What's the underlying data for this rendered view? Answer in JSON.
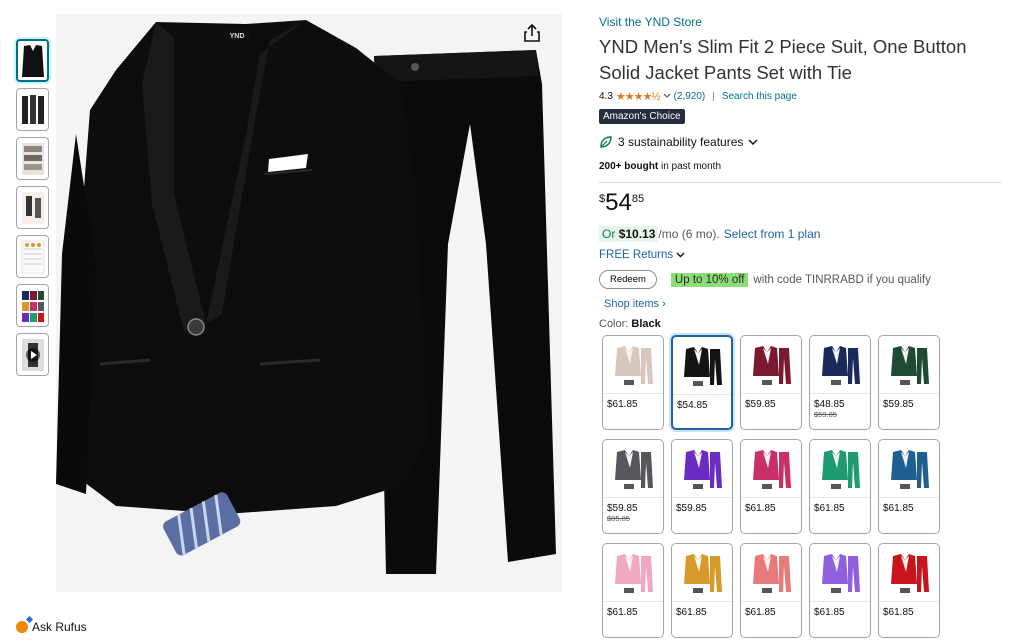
{
  "thumbnails": [
    {
      "name": "thumb-suit-front",
      "selected": true
    },
    {
      "name": "thumb-models"
    },
    {
      "name": "thumb-fabric-details"
    },
    {
      "name": "thumb-size-chart"
    },
    {
      "name": "thumb-size-table"
    },
    {
      "name": "thumb-color-grid"
    },
    {
      "name": "thumb-video"
    }
  ],
  "main_image": {
    "alt": "Black suit jacket, pants and tie",
    "brand_label": "YND"
  },
  "ask_rufus": "Ask Rufus",
  "store_link": "Visit the YND Store",
  "title": "YND Men's Slim Fit 2 Piece Suit, One Button Solid Jacket Pants Set with Tie",
  "rating": {
    "value": "4.3",
    "stars": "★★★★½",
    "count": "(2,920)",
    "search_page": "Search this page"
  },
  "badge": "Amazon's Choice",
  "sustainability": "3 sustainability features",
  "bought": {
    "bold": "200+ bought",
    "rest": " in past month"
  },
  "price": {
    "symbol": "$",
    "whole": "54",
    "fraction": "85"
  },
  "monthly": {
    "or": "Or",
    "amount": "$10.13",
    "rest": "/mo (6 mo).",
    "link": "Select from 1 plan"
  },
  "returns": "FREE Returns",
  "coupon": {
    "button": "Redeem",
    "highlight": "Up to 10% off",
    "text": "with code TINRRABD if you qualify"
  },
  "shop_items": "Shop items ›",
  "color": {
    "label": "Color:",
    "value": "Black"
  },
  "swatches": [
    {
      "name": "beige",
      "price": "$61.85",
      "color": "#d9c7bd"
    },
    {
      "name": "black",
      "price": "$54.85",
      "color": "#141414",
      "selected": true
    },
    {
      "name": "burgundy",
      "price": "$59.85",
      "color": "#7a1a2e"
    },
    {
      "name": "navy",
      "price": "$48.85",
      "old": "$59.85",
      "color": "#1b2a5c"
    },
    {
      "name": "dark-green",
      "price": "$59.85",
      "color": "#1f4a34"
    },
    {
      "name": "gray",
      "price": "$59.85",
      "old": "$85.85",
      "color": "#55575c"
    },
    {
      "name": "purple",
      "price": "$59.85",
      "color": "#6a2cc1"
    },
    {
      "name": "rose",
      "price": "$61.85",
      "color": "#c8306a"
    },
    {
      "name": "green",
      "price": "$61.85",
      "color": "#1e9c70"
    },
    {
      "name": "blue",
      "price": "$61.85",
      "color": "#1f5f92"
    },
    {
      "name": "pink",
      "price": "$61.85",
      "color": "#f0a8c0"
    },
    {
      "name": "mustard",
      "price": "$61.85",
      "color": "#d69a2a"
    },
    {
      "name": "coral",
      "price": "$61.85",
      "color": "#e77b7b"
    },
    {
      "name": "lavender",
      "price": "$61.85",
      "color": "#8f5fe0"
    },
    {
      "name": "red",
      "price": "$61.85",
      "color": "#c9141e"
    }
  ]
}
